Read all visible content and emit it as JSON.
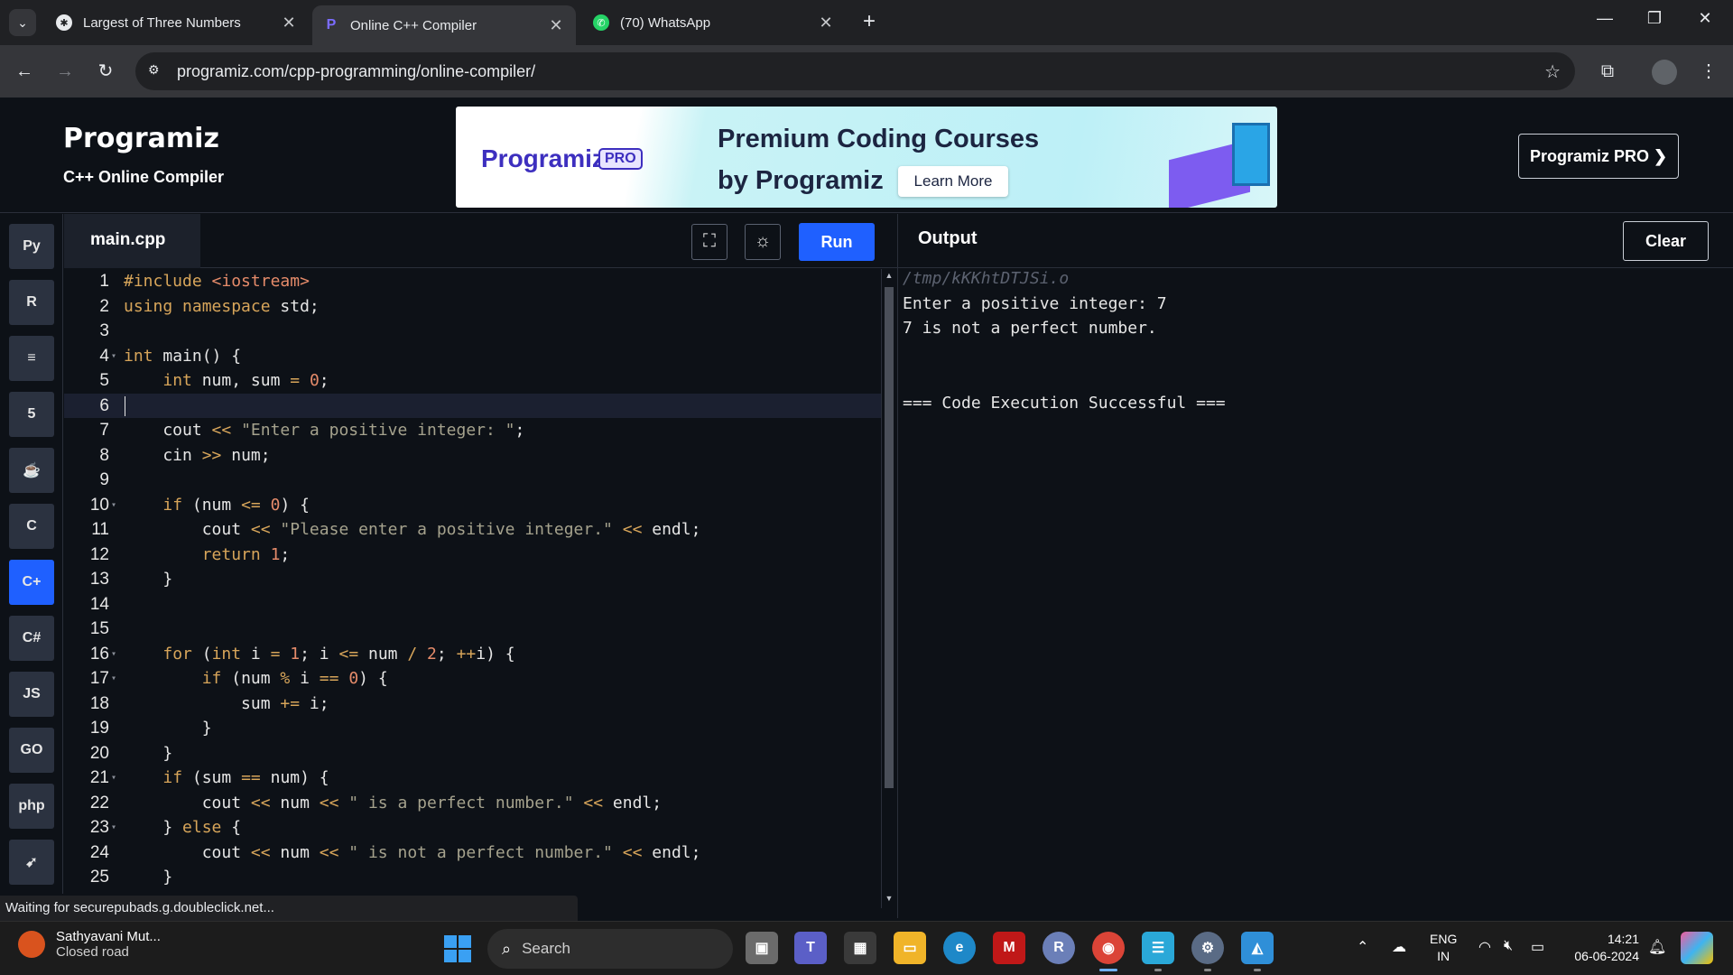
{
  "browser": {
    "tabs": [
      {
        "title": "Largest of Three Numbers",
        "active": false
      },
      {
        "title": "Online C++ Compiler",
        "active": true
      },
      {
        "title": "(70) WhatsApp",
        "active": false
      }
    ],
    "url": "programiz.com/cpp-programming/online-compiler/",
    "status_text": "Waiting for securepubads.g.doubleclick.net..."
  },
  "header": {
    "brand": "Programiz",
    "subtitle": "C++ Online Compiler",
    "pro_button": "Programiz PRO ❯"
  },
  "banner": {
    "logo": "Programiz",
    "badge": "PRO",
    "title_line1": "Premium Coding Courses",
    "title_line2": "by Programiz",
    "cta": "Learn More"
  },
  "languages": [
    {
      "name": "Python",
      "glyph": "Py"
    },
    {
      "name": "R",
      "glyph": "R"
    },
    {
      "name": "SQL",
      "glyph": "≡"
    },
    {
      "name": "HTML",
      "glyph": "5"
    },
    {
      "name": "Java",
      "glyph": "☕"
    },
    {
      "name": "C",
      "glyph": "C"
    },
    {
      "name": "C++",
      "glyph": "C+",
      "active": true
    },
    {
      "name": "C#",
      "glyph": "C#"
    },
    {
      "name": "JavaScript",
      "glyph": "JS"
    },
    {
      "name": "Go",
      "glyph": "GO"
    },
    {
      "name": "PHP",
      "glyph": "php"
    },
    {
      "name": "Swift",
      "glyph": "➹"
    }
  ],
  "editor": {
    "filename": "main.cpp",
    "run_label": "Run",
    "current_line": 6,
    "lines": [
      {
        "n": "1",
        "fold": false,
        "html": "<span class=\"k\">#include</span> <span class=\"n\">&lt;iostream&gt;</span>"
      },
      {
        "n": "2",
        "fold": false,
        "html": "<span class=\"k\">using</span> <span class=\"k\">namespace</span> std;"
      },
      {
        "n": "3",
        "fold": false,
        "html": ""
      },
      {
        "n": "4",
        "fold": true,
        "html": "<span class=\"k\">int</span> main() {"
      },
      {
        "n": "5",
        "fold": false,
        "html": "    <span class=\"k\">int</span> num, sum <span class=\"o\">=</span> <span class=\"n\">0</span>;"
      },
      {
        "n": "6",
        "fold": false,
        "html": ""
      },
      {
        "n": "7",
        "fold": false,
        "html": "    cout <span class=\"o\">&lt;&lt;</span> <span class=\"s\">\"Enter a positive integer: \"</span>;"
      },
      {
        "n": "8",
        "fold": false,
        "html": "    cin <span class=\"o\">&gt;&gt;</span> num;"
      },
      {
        "n": "9",
        "fold": false,
        "html": ""
      },
      {
        "n": "10",
        "fold": true,
        "html": "    <span class=\"k\">if</span> (num <span class=\"o\">&lt;=</span> <span class=\"n\">0</span>) {"
      },
      {
        "n": "11",
        "fold": false,
        "html": "        cout <span class=\"o\">&lt;&lt;</span> <span class=\"s\">\"Please enter a positive integer.\"</span> <span class=\"o\">&lt;&lt;</span> endl;"
      },
      {
        "n": "12",
        "fold": false,
        "html": "        <span class=\"k\">return</span> <span class=\"n\">1</span>;"
      },
      {
        "n": "13",
        "fold": false,
        "html": "    }"
      },
      {
        "n": "14",
        "fold": false,
        "html": ""
      },
      {
        "n": "15",
        "fold": false,
        "html": ""
      },
      {
        "n": "16",
        "fold": true,
        "html": "    <span class=\"k\">for</span> (<span class=\"k\">int</span> i <span class=\"o\">=</span> <span class=\"n\">1</span>; i <span class=\"o\">&lt;=</span> num <span class=\"o\">/</span> <span class=\"n\">2</span>; <span class=\"o\">++</span>i) {"
      },
      {
        "n": "17",
        "fold": true,
        "html": "        <span class=\"k\">if</span> (num <span class=\"o\">%</span> i <span class=\"o\">==</span> <span class=\"n\">0</span>) {"
      },
      {
        "n": "18",
        "fold": false,
        "html": "            sum <span class=\"o\">+=</span> i;"
      },
      {
        "n": "19",
        "fold": false,
        "html": "        }"
      },
      {
        "n": "20",
        "fold": false,
        "html": "    }"
      },
      {
        "n": "21",
        "fold": true,
        "html": "    <span class=\"k\">if</span> (sum <span class=\"o\">==</span> num) {"
      },
      {
        "n": "22",
        "fold": false,
        "html": "        cout <span class=\"o\">&lt;&lt;</span> num <span class=\"o\">&lt;&lt;</span> <span class=\"s\">\" is a perfect number.\"</span> <span class=\"o\">&lt;&lt;</span> endl;"
      },
      {
        "n": "23",
        "fold": true,
        "html": "    } <span class=\"k\">else</span> {"
      },
      {
        "n": "24",
        "fold": false,
        "html": "        cout <span class=\"o\">&lt;&lt;</span> num <span class=\"o\">&lt;&lt;</span> <span class=\"s\">\" is not a perfect number.\"</span> <span class=\"o\">&lt;&lt;</span> endl;"
      },
      {
        "n": "25",
        "fold": false,
        "html": "    }"
      }
    ]
  },
  "output": {
    "title": "Output",
    "clear_label": "Clear",
    "path": "/tmp/kKKhtDTJSi.o",
    "lines": [
      "Enter a positive integer: 7",
      "7 is not a perfect number.",
      "",
      "",
      "=== Code Execution Successful ==="
    ]
  },
  "taskbar": {
    "weather_title": "Sathyavani Mut...",
    "weather_sub": "Closed road",
    "search_label": "Search",
    "lang_line1": "ENG",
    "lang_line2": "IN",
    "time": "14:21",
    "date": "06-06-2024"
  },
  "colors": {
    "accent": "#1f60ff",
    "editor_bg": "#0d1117",
    "keyword": "#d7a55a",
    "string": "#a5a28d",
    "number": "#e58b6a"
  }
}
